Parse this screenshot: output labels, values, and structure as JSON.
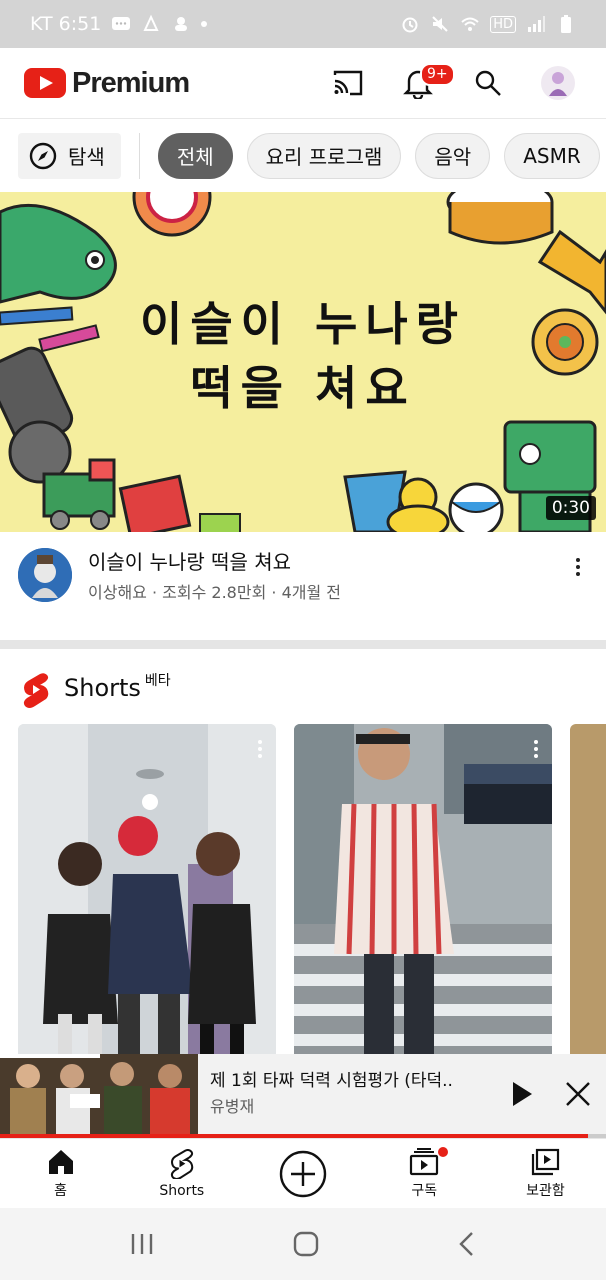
{
  "status_bar": {
    "carrier_time": "KT 6:51",
    "chat_icon_label": "...",
    "network_label": "HD"
  },
  "top_bar": {
    "logo_text": "Premium",
    "notification_badge": "9+",
    "icons": [
      "cast-icon",
      "bell-icon",
      "search-icon",
      "avatar"
    ]
  },
  "chips": {
    "explore_label": "탐색",
    "items": [
      "전체",
      "요리 프로그램",
      "음악",
      "ASMR"
    ],
    "active_index": 0
  },
  "video": {
    "thumbnail_title_line1": "이슬이 누나랑",
    "thumbnail_title_line2": "떡을 쳐요",
    "duration": "0:30",
    "title": "이슬이 누나랑 떡을 쳐요",
    "channel": "이상해요",
    "views": "조회수 2.8만회",
    "age": "4개월 전",
    "meta_sep": " · "
  },
  "shorts": {
    "label": "Shorts",
    "badge": "베타"
  },
  "mini_player": {
    "title": "제 1회 타짜 덕력 시험평가 (타덕..",
    "channel": "유병재",
    "progress": 0.97
  },
  "bottom_nav": {
    "items": [
      {
        "label": "홈"
      },
      {
        "label": "Shorts"
      },
      {
        "label": ""
      },
      {
        "label": "구독"
      },
      {
        "label": "보관함"
      }
    ]
  },
  "colors": {
    "brand_red": "#e62117",
    "chip_active": "#606060",
    "thumb_bg": "#f5ee9e"
  }
}
